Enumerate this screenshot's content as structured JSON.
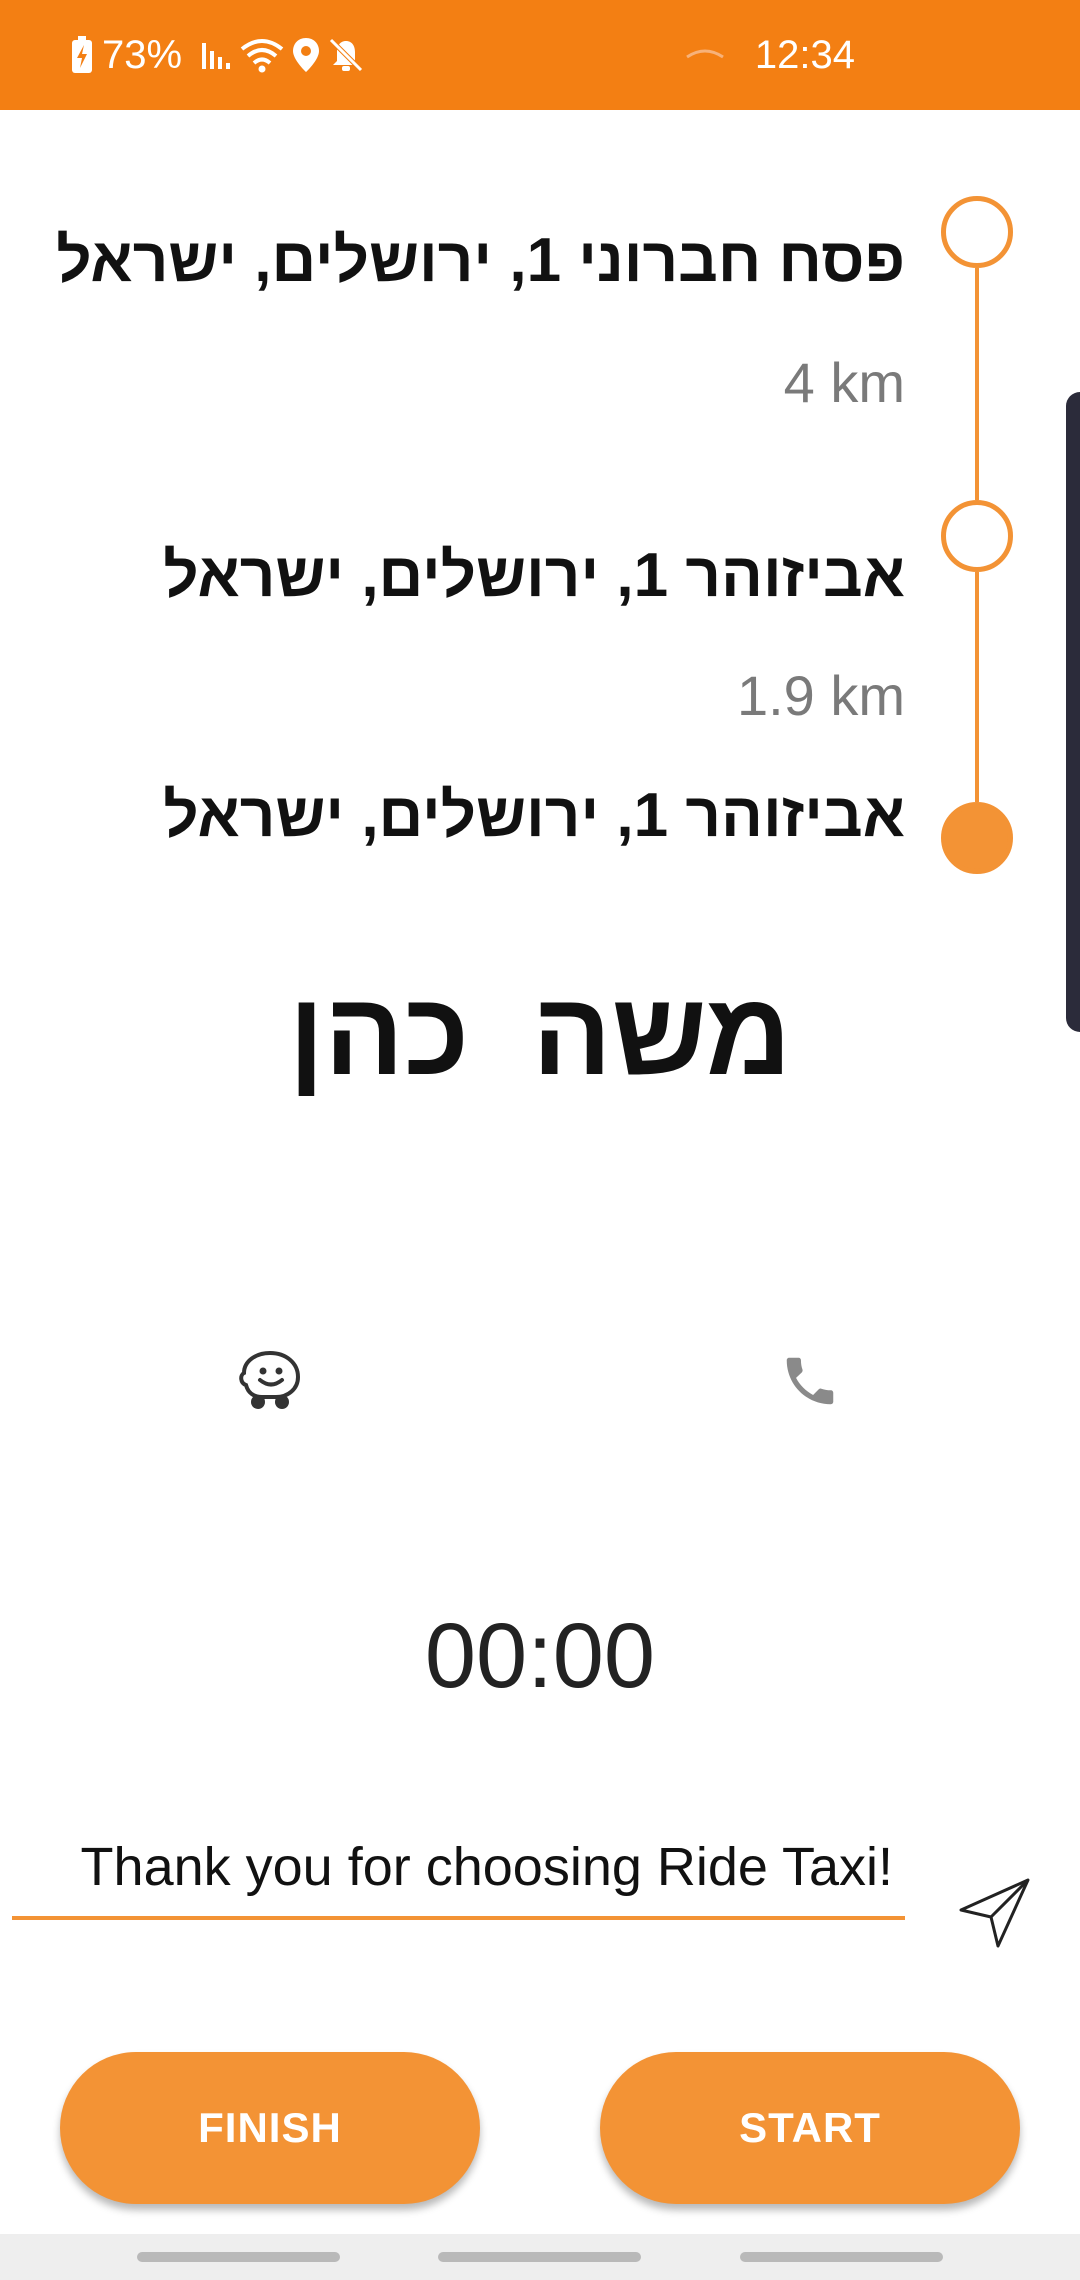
{
  "status_bar": {
    "battery": "73%",
    "time": "12:34",
    "background": "#F37F13",
    "icons": [
      "battery-charging-icon",
      "signal-icon",
      "wifi-icon",
      "location-icon",
      "mute-icon",
      "cast-icon"
    ]
  },
  "route": {
    "accent": "#F39335",
    "stops": [
      {
        "address": "פסח חברוני 1, ירושלים, ישראל",
        "node": "hollow"
      },
      {
        "address": "אביזוהר 1, ירושלים, ישראל",
        "node": "hollow"
      },
      {
        "address": "אביזוהר 1, ירושלים, ישראל",
        "node": "filled"
      }
    ],
    "distances": [
      "4 km",
      "1.9 km"
    ]
  },
  "driver": {
    "name": "משה  כהן"
  },
  "actions": {
    "navigate_icon": "waze-icon",
    "call_icon": "phone-icon"
  },
  "timer": "00:00",
  "message": {
    "value": "Thank you for choosing Ride Taxi!",
    "send_icon": "send-icon"
  },
  "buttons": {
    "finish": "FINISH",
    "start": "START"
  }
}
